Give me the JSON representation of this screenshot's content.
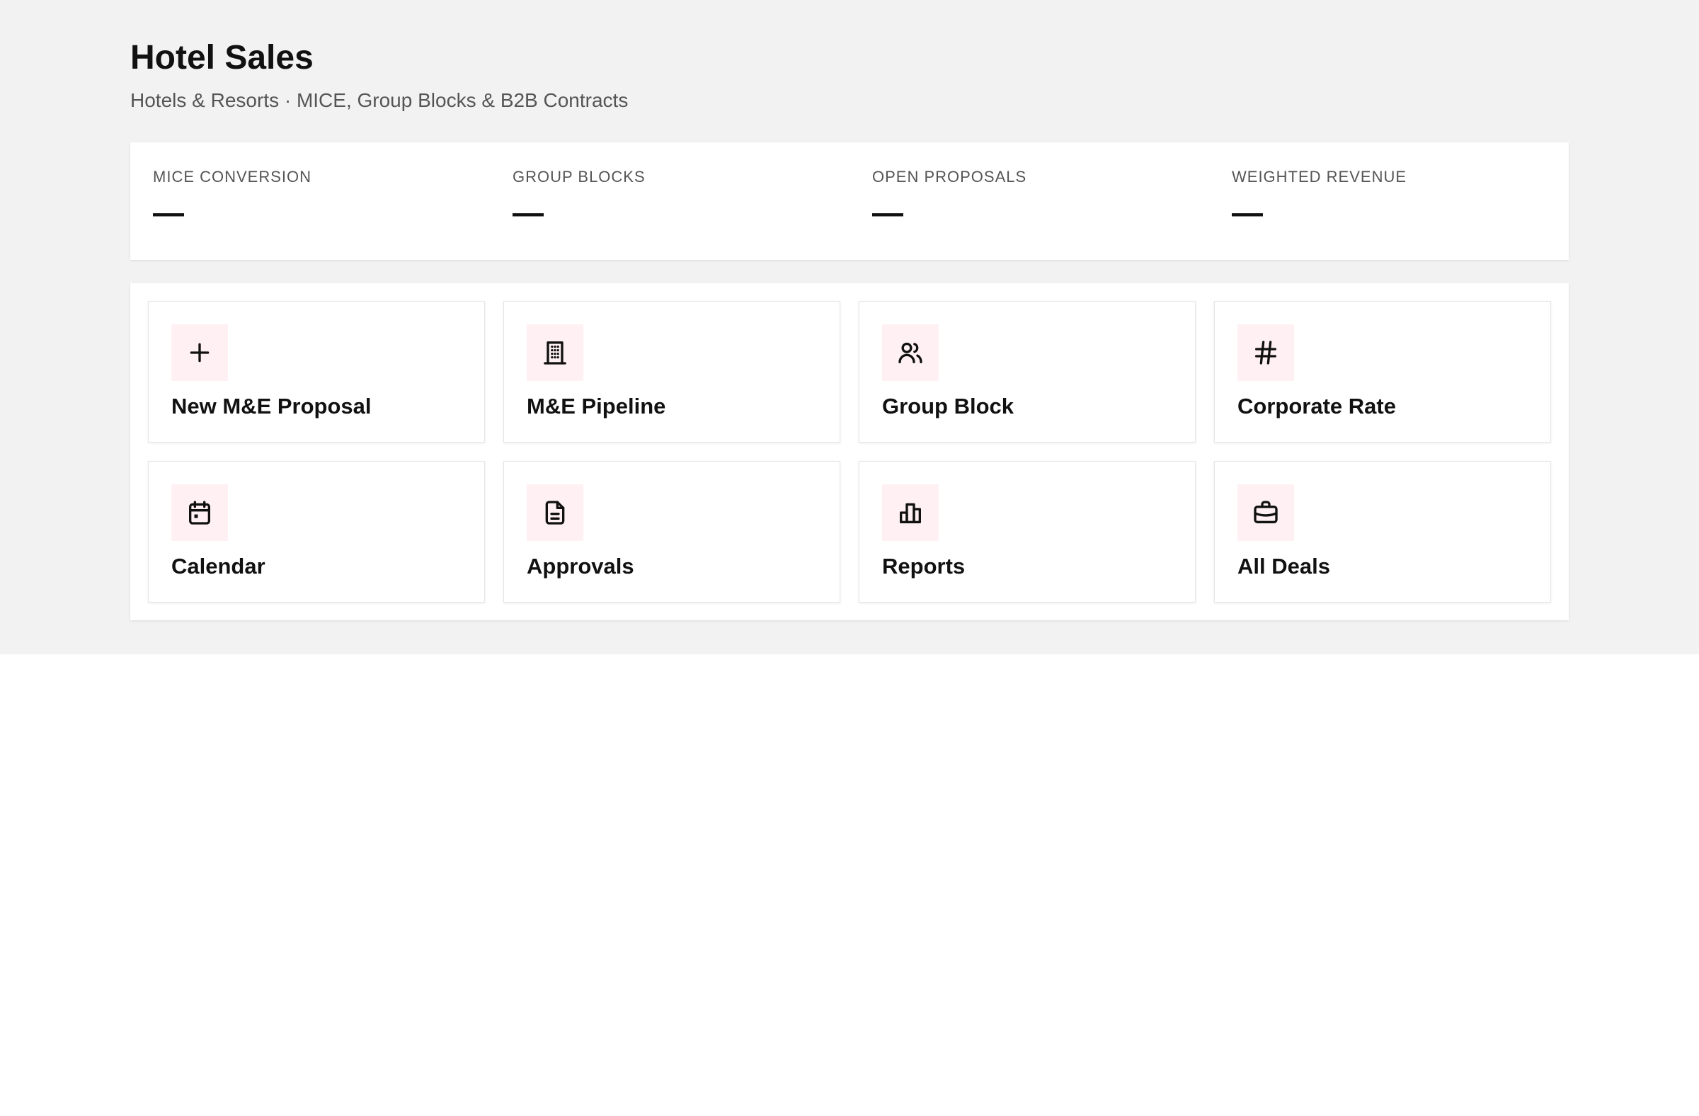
{
  "header": {
    "title": "Hotel Sales",
    "subtitle": "Hotels & Resorts · MICE, Group Blocks & B2B Contracts"
  },
  "kpis": [
    {
      "label": "MICE CONVERSION",
      "value": "—"
    },
    {
      "label": "GROUP BLOCKS",
      "value": "—"
    },
    {
      "label": "OPEN PROPOSALS",
      "value": "—"
    },
    {
      "label": "WEIGHTED REVENUE",
      "value": "—"
    }
  ],
  "actions": [
    {
      "label": "New M&E Proposal",
      "icon": "plus-icon"
    },
    {
      "label": "M&E Pipeline",
      "icon": "building-icon"
    },
    {
      "label": "Group Block",
      "icon": "users-icon"
    },
    {
      "label": "Corporate Rate",
      "icon": "hash-icon"
    },
    {
      "label": "Calendar",
      "icon": "calendar-icon"
    },
    {
      "label": "Approvals",
      "icon": "document-icon"
    },
    {
      "label": "Reports",
      "icon": "bar-chart-icon"
    },
    {
      "label": "All Deals",
      "icon": "briefcase-icon"
    }
  ],
  "colors": {
    "page_background": "#f2f2f2",
    "icon_tile_background": "#fff1f3",
    "text_primary": "#111111",
    "text_secondary": "#555555"
  }
}
